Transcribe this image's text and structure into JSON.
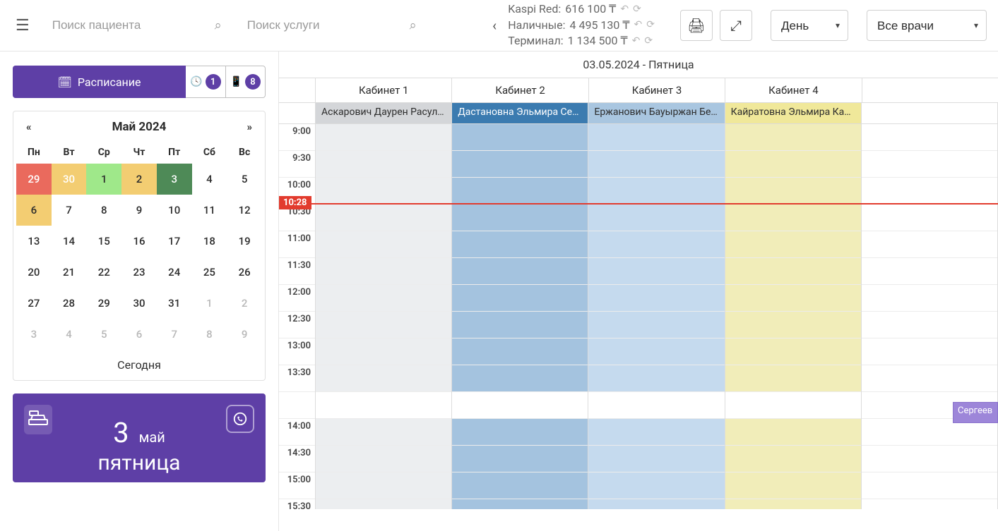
{
  "searchPatient": {
    "placeholder": "Поиск пациента"
  },
  "searchService": {
    "placeholder": "Поиск услуги"
  },
  "balances": {
    "kaspi_label": "Kaspi Red:",
    "kaspi_value": "616 100 ₸",
    "cash_label": "Наличные:",
    "cash_value": "4 495 130 ₸",
    "terminal_label": "Терминал:",
    "terminal_value": "1 134 500 ₸"
  },
  "viewSelect": {
    "label": "День"
  },
  "doctorSelect": {
    "label": "Все врачи"
  },
  "scheduleBtn": {
    "label": "Расписание"
  },
  "badge1": "1",
  "badge2": "8",
  "calendar": {
    "title": "Май 2024",
    "prev": "«",
    "next": "»",
    "dayHeaders": [
      "Пн",
      "Вт",
      "Ср",
      "Чт",
      "Пт",
      "Сб",
      "Вс"
    ],
    "weeks": [
      [
        {
          "d": "29",
          "c": "red"
        },
        {
          "d": "30",
          "c": "orange"
        },
        {
          "d": "1",
          "c": "green"
        },
        {
          "d": "2",
          "c": "yellow"
        },
        {
          "d": "3",
          "c": "dgreen"
        },
        {
          "d": "4"
        },
        {
          "d": "5"
        }
      ],
      [
        {
          "d": "6",
          "c": "yellow"
        },
        {
          "d": "7"
        },
        {
          "d": "8"
        },
        {
          "d": "9"
        },
        {
          "d": "10"
        },
        {
          "d": "11"
        },
        {
          "d": "12"
        }
      ],
      [
        {
          "d": "13"
        },
        {
          "d": "14"
        },
        {
          "d": "15"
        },
        {
          "d": "16"
        },
        {
          "d": "17"
        },
        {
          "d": "18"
        },
        {
          "d": "19"
        }
      ],
      [
        {
          "d": "20"
        },
        {
          "d": "21"
        },
        {
          "d": "22"
        },
        {
          "d": "23"
        },
        {
          "d": "24"
        },
        {
          "d": "25"
        },
        {
          "d": "26"
        }
      ],
      [
        {
          "d": "27"
        },
        {
          "d": "28"
        },
        {
          "d": "29"
        },
        {
          "d": "30"
        },
        {
          "d": "31"
        },
        {
          "d": "1",
          "dim": true
        },
        {
          "d": "2",
          "dim": true
        }
      ],
      [
        {
          "d": "3",
          "dim": true
        },
        {
          "d": "4",
          "dim": true
        },
        {
          "d": "5",
          "dim": true
        },
        {
          "d": "6",
          "dim": true
        },
        {
          "d": "7",
          "dim": true
        },
        {
          "d": "8",
          "dim": true
        },
        {
          "d": "9",
          "dim": true
        }
      ]
    ],
    "today": "Сегодня"
  },
  "dateCard": {
    "day": "3",
    "month": "май",
    "weekday": "пятница"
  },
  "schedule": {
    "title": "03.05.2024 - Пятница",
    "rooms": [
      "Кабинет 1",
      "Кабинет 2",
      "Кабинет 3",
      "Кабинет 4"
    ],
    "doctors": [
      {
        "name": "Аскарович Даурен Расулов",
        "cls": "doc-gray"
      },
      {
        "name": "Дастановна Эльмира Сери…",
        "cls": "doc-blue"
      },
      {
        "name": "Ержанович Бауыржан Беке…",
        "cls": "doc-lblue"
      },
      {
        "name": "Кайратовна Эльмира Кари…",
        "cls": "doc-yellow"
      }
    ],
    "times": [
      "9:00",
      "9:30",
      "10:00",
      "10:30",
      "11:00",
      "11:30",
      "12:00",
      "12:30",
      "13:00",
      "13:30",
      "",
      "14:00",
      "14:30",
      "15:00",
      "15:30"
    ],
    "nowTime": "10:28",
    "nowOffsetPx": 112,
    "sideEvent": {
      "label": "Сергеев",
      "topPx": 394,
      "heightPx": 30
    }
  }
}
